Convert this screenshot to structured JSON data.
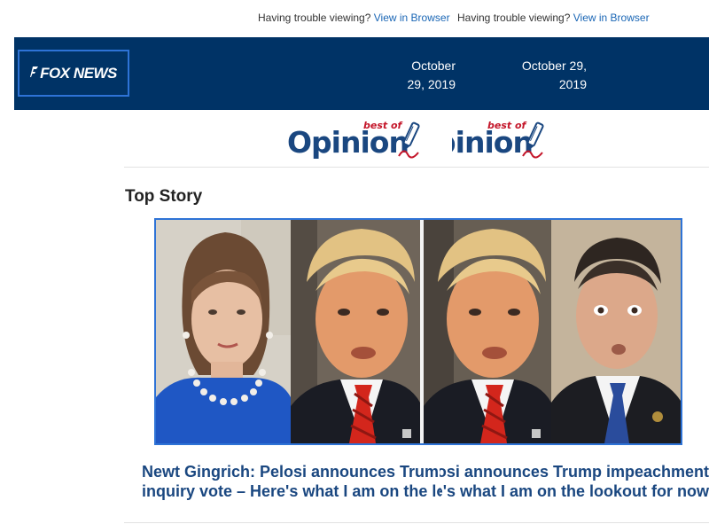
{
  "topbar": {
    "trouble_text": "Having trouble viewing? ",
    "view_link": "View in Browser"
  },
  "header": {
    "logo_text": "FOX NEWS",
    "date": "October 29, 2019",
    "brand_color": "#003366"
  },
  "opinion": {
    "word": "Opinion",
    "best_of": "best of",
    "pen_icon": "pen-icon"
  },
  "section": {
    "title": "Top Story"
  },
  "story": {
    "image_alt": "Pelosi, Trump and Schiff",
    "headline_line1": "Newt Gingrich: Pelosi announces Trump impeachment",
    "headline_line2": "inquiry vote – Here's what I am on the lookout for now"
  },
  "colors": {
    "link": "#1a66b5",
    "headline": "#1a4780",
    "opinion_red": "#c4162a",
    "frame_blue": "#2e73d6"
  }
}
